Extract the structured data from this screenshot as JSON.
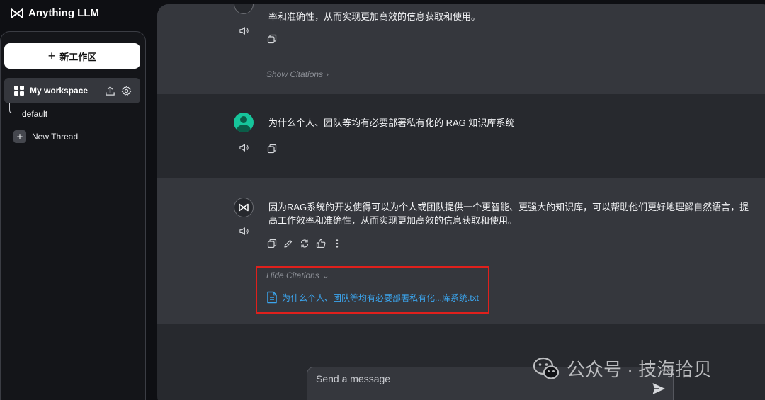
{
  "app": {
    "title": "Anything LLM"
  },
  "sidebar": {
    "new_workspace_label": "新工作区",
    "workspace": {
      "name": "My workspace"
    },
    "threads": [
      {
        "label": "default"
      }
    ],
    "new_thread_label": "New Thread"
  },
  "chat": {
    "messages": [
      {
        "role": "assistant",
        "text": "率和准确性，从而实现更加高效的信息获取和使用。",
        "citations_toggle": "Show Citations"
      },
      {
        "role": "user",
        "text": "为什么个人、团队等均有必要部署私有化的 RAG 知识库系统"
      },
      {
        "role": "assistant",
        "text": "因为RAG系统的开发使得可以为个人或团队提供一个更智能、更强大的知识库，可以帮助他们更好地理解自然语言，提高工作效率和准确性，从而实现更加高效的信息获取和使用。",
        "citations_toggle": "Hide Citations",
        "citation_file": "为什么个人、团队等均有必要部署私有化...库系统.txt"
      }
    ]
  },
  "composer": {
    "placeholder": "Send a message"
  },
  "watermark": {
    "text": "公众号 · 技海拾贝"
  },
  "colors": {
    "accent_blue": "#3ba5ee",
    "highlight_red": "#e0201c",
    "user_avatar": "#16c59b"
  }
}
